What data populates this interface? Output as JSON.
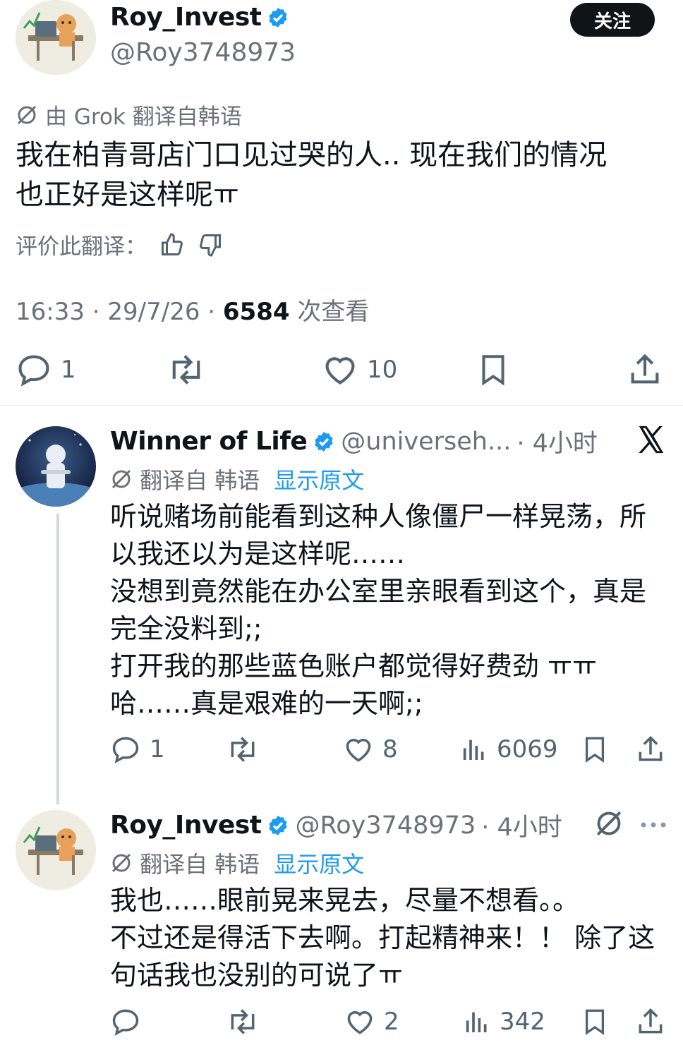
{
  "main_tweet": {
    "display_name": "Roy_Invest",
    "handle": "@Roy3748973",
    "follow_label": "关注",
    "translate_note": "由 Grok 翻译自韩语",
    "text": "我在柏青哥店门口见过哭的人.. 现在我们的情况\n也正好是这样呢ㅠ",
    "rate_label": "评价此翻译：",
    "time": "16:33 · 29/7/26 · ",
    "views_count": "6584",
    "views_label": " 次查看",
    "reply_count": "1",
    "like_count": "10"
  },
  "reply1": {
    "display_name": "Winner of Life",
    "handle": "@universeh...",
    "time": "· 4小时",
    "translate_note": "翻译自 韩语",
    "show_original": "显示原文",
    "text": "听说赌场前能看到这种人像僵尸一样晃荡，所\n以我还以为是这样呢……\n没想到竟然能在办公室里亲眼看到这个，真是\n完全没料到;;\n打开我的那些蓝色账户都觉得好费劲 ㅠㅠ\n哈……真是艰难的一天啊;;",
    "reply_count": "1",
    "like_count": "8",
    "views": "6069"
  },
  "reply2": {
    "display_name": "Roy_Invest",
    "handle": "@Roy3748973",
    "time": "· 4小时",
    "translate_note": "翻译自 韩语",
    "show_original": "显示原文",
    "text": "我也……眼前晃来晃去，尽量不想看。。\n不过还是得活下去啊。打起精神来！！ 除了这\n句话我也没别的可说了ㅠ",
    "like_count": "2",
    "views": "342"
  },
  "colors": {
    "accent": "#1d9bf0",
    "text": "#0f1419",
    "muted": "#536471",
    "thread_line": "#cfd9de"
  }
}
